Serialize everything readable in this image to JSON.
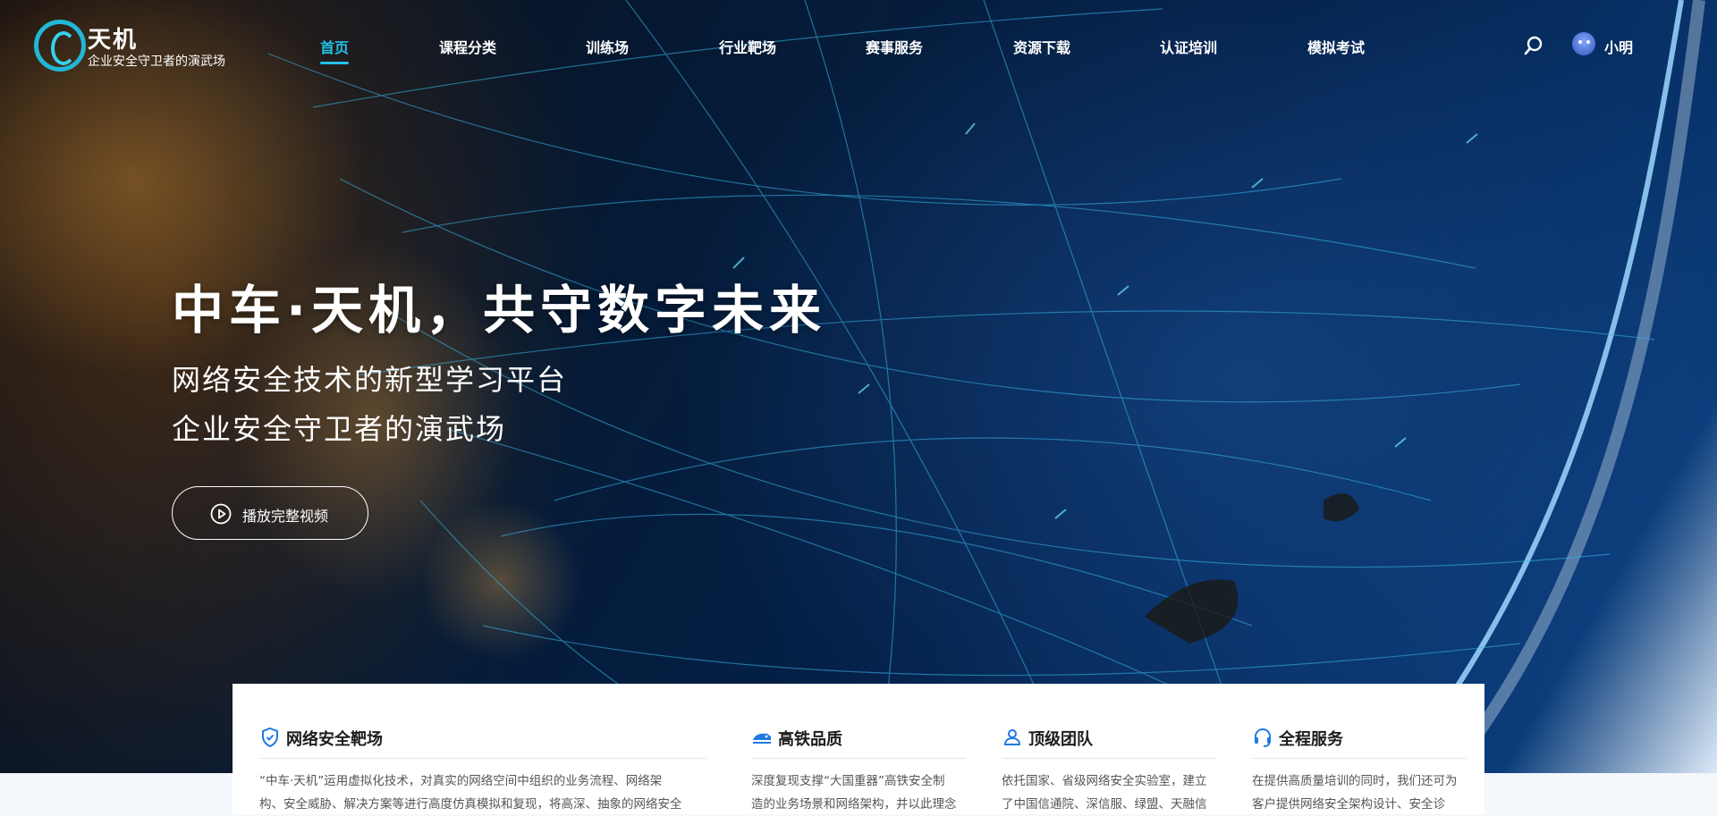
{
  "brand": {
    "title": "天机",
    "subtitle": "企业安全守卫者的演武场",
    "accent": "#22c3e6"
  },
  "nav": {
    "items": [
      {
        "label": "首页",
        "active": true
      },
      {
        "label": "课程分类"
      },
      {
        "label": "训练场"
      },
      {
        "label": "行业靶场"
      },
      {
        "label": "赛事服务"
      },
      {
        "label": "资源下载"
      },
      {
        "label": "认证培训"
      },
      {
        "label": "模拟考试"
      }
    ],
    "search_icon": "search-icon",
    "user_name": "小明"
  },
  "hero": {
    "title": "中车·天机，共守数字未来",
    "subtitle_1": "网络安全技术的新型学习平台",
    "subtitle_2": "企业安全守卫者的演武场",
    "play_label": "播放完整视频"
  },
  "features": [
    {
      "title": "网络安全靶场",
      "icon": "shield-check-icon",
      "lines": [
        "“中车·天机”运用虚拟化技术，对真实的网络空间中组织的业务流程、网络架",
        "构、安全威胁、解决方案等进行高度仿真模拟和复现，将高深、抽象的网络安全"
      ]
    },
    {
      "title": "高铁品质",
      "icon": "train-icon",
      "lines": [
        "深度复现支撑“大国重器”高铁安全制",
        "造的业务场景和网络架构，并以此理念"
      ]
    },
    {
      "title": "顶级团队",
      "icon": "team-icon",
      "lines": [
        "依托国家、省级网络安全实验室，建立",
        "了中国信通院、深信服、绿盟、天融信"
      ]
    },
    {
      "title": "全程服务",
      "icon": "headset-icon",
      "lines": [
        "在提供高质量培训的同时，我们还可为",
        "客户提供网络安全架构设计、安全诊"
      ]
    }
  ]
}
